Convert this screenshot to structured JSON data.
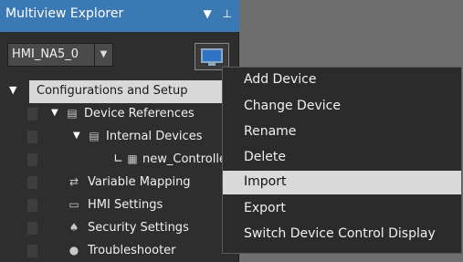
{
  "panel": {
    "title": "Multiview Explorer",
    "dropdown_icon": "▼",
    "pin_icon": "⊥",
    "device_select_value": "HMI_NA5_0",
    "select_arrow": "▼"
  },
  "tree": {
    "root_label": "Configurations and Setup",
    "items": [
      {
        "label": "Device References"
      },
      {
        "label": "Internal Devices"
      },
      {
        "label": "new_Controlle"
      },
      {
        "label": "Variable Mapping"
      },
      {
        "label": "HMI Settings"
      },
      {
        "label": "Security Settings"
      },
      {
        "label": "Troubleshooter"
      }
    ]
  },
  "context_menu": {
    "items": [
      {
        "label": "Add Device"
      },
      {
        "label": "Change Device"
      },
      {
        "label": "Rename"
      },
      {
        "label": "Delete"
      },
      {
        "label": "Import"
      },
      {
        "label": "Export"
      },
      {
        "label": "Switch Device Control Display"
      }
    ],
    "highlighted": "Import"
  }
}
